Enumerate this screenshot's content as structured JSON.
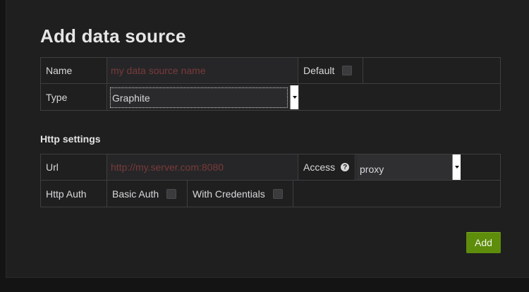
{
  "title": "Add data source",
  "basic": {
    "name_label": "Name",
    "name_placeholder": "my data source name",
    "default_label": "Default",
    "type_label": "Type",
    "type_value": "Graphite"
  },
  "http": {
    "section_title": "Http settings",
    "url_label": "Url",
    "url_placeholder": "http://my.server.com:8080",
    "access_label": "Access",
    "access_value": "proxy",
    "auth_label": "Http Auth",
    "basic_auth_label": "Basic Auth",
    "with_credentials_label": "With Credentials"
  },
  "actions": {
    "add_label": "Add"
  },
  "colors": {
    "accent": "#5e8d0b",
    "placeholder": "#7a3a3a",
    "background": "#1f1f20"
  }
}
